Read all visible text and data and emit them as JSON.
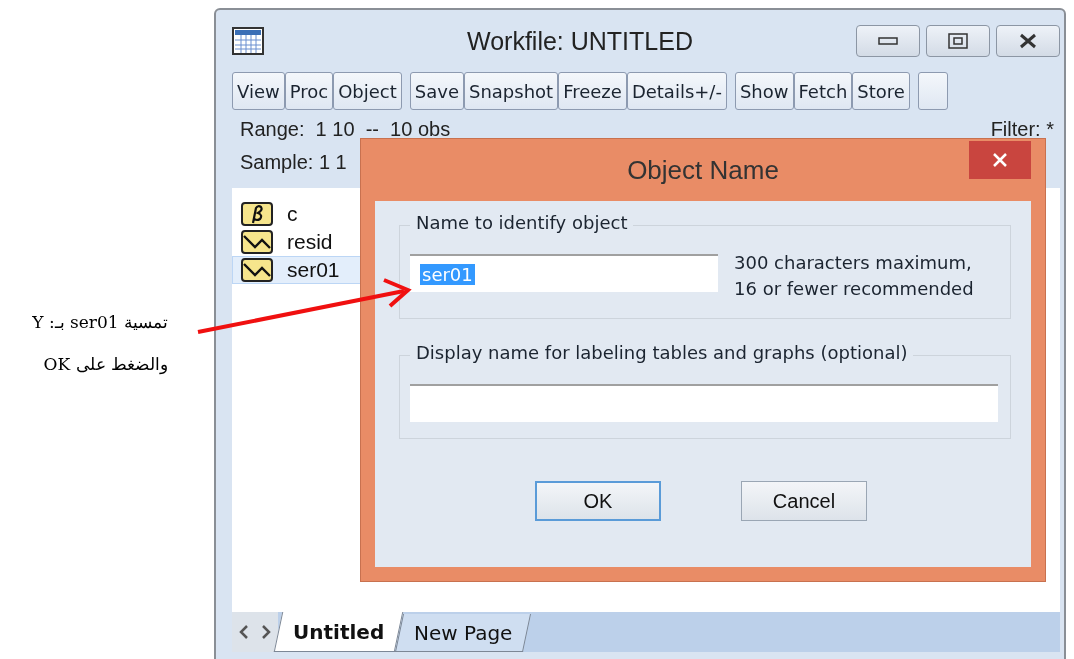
{
  "annotation": {
    "lines": [
      "تمسية ser01 بـ: Y",
      "والضغط على OK"
    ]
  },
  "workfile": {
    "title": "Workfile: UNTITLED",
    "toolbar": [
      [
        "View",
        "Proc",
        "Object"
      ],
      [
        "Save",
        "Snapshot",
        "Freeze",
        "Details+/-"
      ],
      [
        "Show",
        "Fetch",
        "Store"
      ]
    ],
    "range": "Range:  1 10  --  10 obs",
    "filter": "Filter: *",
    "sample": "Sample: 1 1",
    "objects": [
      {
        "name": "c",
        "kind": "coef",
        "selected": false
      },
      {
        "name": "resid",
        "kind": "series",
        "selected": false
      },
      {
        "name": "ser01",
        "kind": "series",
        "selected": true
      }
    ],
    "tabs": [
      {
        "label": "Untitled",
        "selected": true
      },
      {
        "label": "New Page",
        "selected": false
      }
    ]
  },
  "dialog": {
    "title": "Object Name",
    "name_group": {
      "label": "Name to identify object",
      "value": "ser01",
      "text_selected": true,
      "hint_lines": [
        "300 characters maximum,",
        "16 or fewer recommended"
      ]
    },
    "display_group": {
      "label": "Display name for labeling tables and graphs  (optional)"
    },
    "buttons": [
      "OK",
      "Cancel"
    ]
  }
}
